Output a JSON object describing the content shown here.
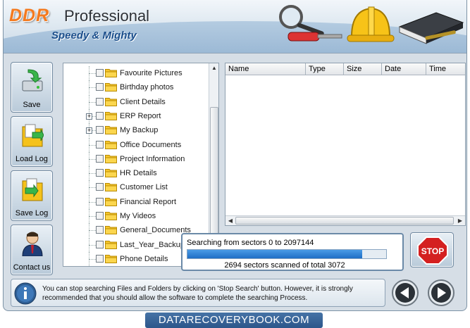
{
  "header": {
    "brand": "DDR",
    "product": "Professional",
    "tagline": "Speedy & Mighty"
  },
  "sidebar": {
    "buttons": [
      {
        "label": "Save",
        "icon": "drive-save-icon"
      },
      {
        "label": "Load Log",
        "icon": "folder-load-icon"
      },
      {
        "label": "Save Log",
        "icon": "folder-save-icon"
      },
      {
        "label": "Contact us",
        "icon": "contact-person-icon"
      }
    ]
  },
  "tree": {
    "items": [
      {
        "label": "Favourite Pictures",
        "expandable": false
      },
      {
        "label": "Birthday photos",
        "expandable": false
      },
      {
        "label": "Client Details",
        "expandable": false
      },
      {
        "label": "ERP Report",
        "expandable": true
      },
      {
        "label": "My Backup",
        "expandable": true
      },
      {
        "label": "Office Documents",
        "expandable": false
      },
      {
        "label": "Project Information",
        "expandable": false
      },
      {
        "label": "HR Details",
        "expandable": false
      },
      {
        "label": "Customer List",
        "expandable": false
      },
      {
        "label": "Financial Report",
        "expandable": false
      },
      {
        "label": "My Videos",
        "expandable": false
      },
      {
        "label": "General_Documents",
        "expandable": false
      },
      {
        "label": "Last_Year_Backup",
        "expandable": false
      },
      {
        "label": "Phone Details",
        "expandable": false
      }
    ]
  },
  "filelist": {
    "columns": [
      "Name",
      "Type",
      "Size",
      "Date",
      "Time"
    ]
  },
  "progress": {
    "message": "Searching from sectors  0 to 2097144",
    "status": "2694  sectors scanned of total 3072",
    "fraction": 0.88
  },
  "stop": {
    "label": "STOP"
  },
  "info": {
    "text": "You can stop searching Files and Folders by clicking on 'Stop Search' button. However, it is strongly recommended that you should allow the software to complete the searching Process."
  },
  "footer": {
    "banner": "DATARECOVERYBOOK.COM"
  },
  "colors": {
    "brand": "#f47a1f",
    "tagline": "#1c4f8c",
    "progress": "#1f6ec5",
    "stop": "#d42020"
  }
}
